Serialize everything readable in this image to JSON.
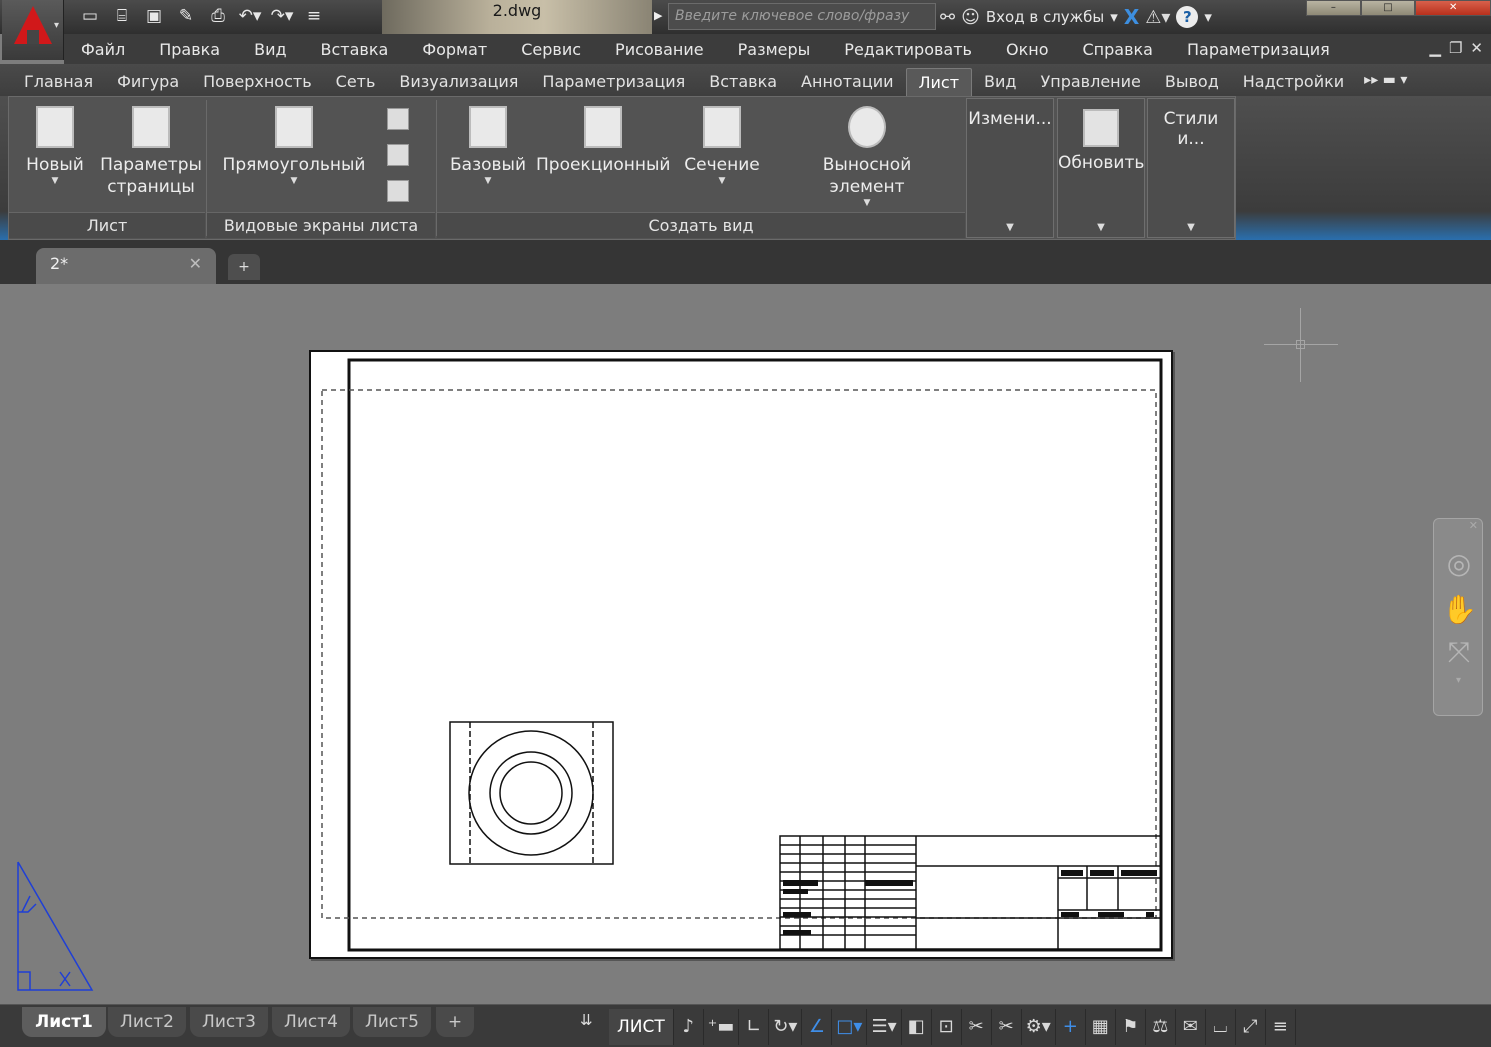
{
  "app": {
    "document_title": "2.dwg",
    "search_placeholder": "Введите ключевое слово/фразу",
    "signin_label": "Вход в службы",
    "window_controls": [
      "–",
      "□",
      "✕"
    ]
  },
  "quick_access": [
    "new-icon",
    "open-icon",
    "save-icon",
    "saveas-icon",
    "print-icon",
    "undo-icon",
    "redo-icon",
    "customize-icon"
  ],
  "menubar": {
    "items": [
      "Файл",
      "Правка",
      "Вид",
      "Вставка",
      "Формат",
      "Сервис",
      "Рисование",
      "Размеры",
      "Редактировать",
      "Окно",
      "Справка",
      "Параметризация"
    ]
  },
  "ribbon_tabs": {
    "items": [
      "Главная",
      "Фигура",
      "Поверхность",
      "Сеть",
      "Визуализация",
      "Параметризация",
      "Вставка",
      "Аннотации",
      "Лист",
      "Вид",
      "Управление",
      "Вывод",
      "Надстройки"
    ],
    "active": "Лист"
  },
  "ribbon": {
    "new_label": "Новый",
    "page_setup_label": "Параметры страницы",
    "rect_label": "Прямоугольный",
    "base_label": "Базовый",
    "projected_label": "Проекционный",
    "section_label": "Сечение",
    "detail_label": "Выносной элемент",
    "modify_label": "Измени...",
    "update_label": "Обновить",
    "styles_label": "Стили и...",
    "panel_layout": "Лист",
    "panel_viewports": "Видовые экраны листа",
    "panel_create_view": "Создать вид"
  },
  "doc_tabs": {
    "active_label": "2*"
  },
  "layout_tabs": [
    "Лист1",
    "Лист2",
    "Лист3",
    "Лист4",
    "Лист5"
  ],
  "status": {
    "mode_label": "ЛИСТ"
  },
  "colors": {
    "ucs_blue": "#1f3fd6",
    "autocad_red": "#d1181a"
  }
}
